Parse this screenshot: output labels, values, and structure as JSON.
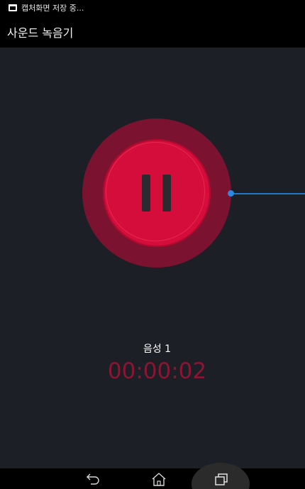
{
  "status_bar": {
    "notification_text": "캡처화면 저장 중..."
  },
  "title_bar": {
    "title": "사운드 녹음기"
  },
  "recorder": {
    "recording_name": "음성 1",
    "elapsed_time": "00:00:02",
    "button_state": "pause",
    "colors": {
      "outer_ring": "#7a1230",
      "button": "#d40d3a",
      "time_text": "#8a1633",
      "waveform": "#1f78c8"
    }
  },
  "nav_bar": {
    "back_icon": "back-arrow-icon",
    "home_icon": "home-icon",
    "recent_icon": "recent-apps-icon"
  }
}
